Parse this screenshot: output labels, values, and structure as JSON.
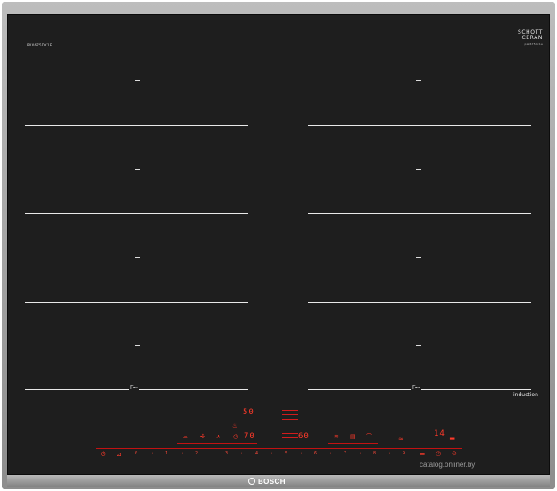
{
  "hob": {
    "model_text": "PXX675DC1E",
    "glass_brand": {
      "line1": "SCHOTT",
      "line2": "CERAN",
      "sub": "pxx675dc1e"
    },
    "zone_marker": "—",
    "flex_symbol": "ᒥ⊷",
    "induction_label": "induction"
  },
  "controls": {
    "top_display": "50",
    "left_display": "70",
    "mid_display": "60",
    "timer_display": "14",
    "power_scale": [
      "0",
      "·",
      "1",
      "·",
      "2",
      "·",
      "3",
      "·",
      "4",
      "·",
      "5",
      "·",
      "6",
      "·",
      "7",
      "·",
      "8",
      "·",
      "9"
    ],
    "icons": {
      "power": "power-icon",
      "child_lock": "childlock-icon",
      "flame": "fry-sensor-icon",
      "wok": "wok-icon",
      "fan": "fan-icon",
      "clock": "clock-icon",
      "grill": "grill-icon",
      "hot": "hot-icon",
      "wifi": "wifi-icon",
      "settings": "settings-icon",
      "timer": "timer-icon"
    }
  },
  "brand": {
    "name": "BOSCH"
  },
  "watermark": "catalog.onliner.by"
}
